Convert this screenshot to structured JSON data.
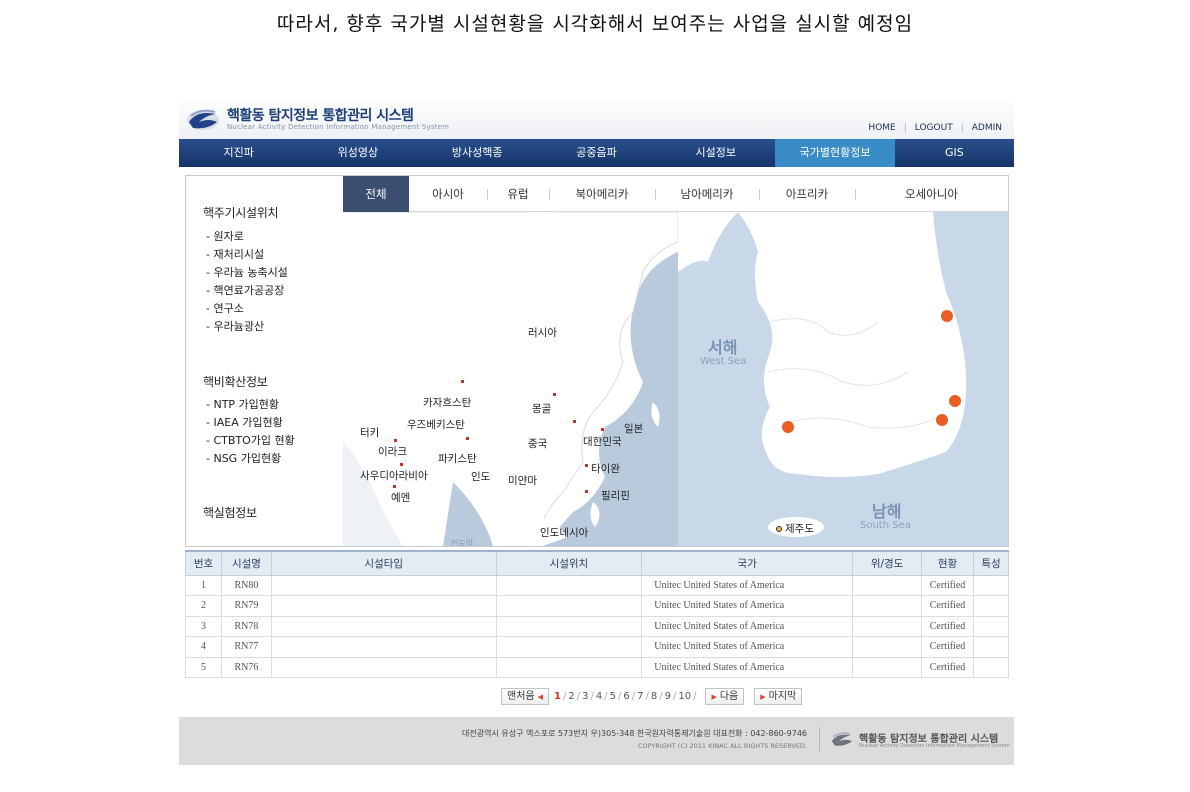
{
  "intro_sentence": "따라서, 향후 국가별 시설현황을 시각화해서 보여주는 사업을 실시할 예정임",
  "header": {
    "title": "핵활동 탐지정보 통합관리 시스템",
    "subtitle": "Nuclear Activity Detection Information Management System",
    "links": [
      "HOME",
      "LOGOUT",
      "ADMIN"
    ]
  },
  "nav": {
    "items": [
      "지진파",
      "위성영상",
      "방사성핵종",
      "공중음파",
      "시설정보",
      "국가별현황정보",
      "GIS"
    ],
    "active": "국가별현황정보"
  },
  "sidebar": {
    "section1": {
      "title": "핵주기시설위치",
      "items": [
        "원자로",
        "재처리시설",
        "우라늄 농축시설",
        "핵연료가공공장",
        "연구소",
        "우라늄광산"
      ]
    },
    "section2": {
      "title": "핵비확산정보",
      "items": [
        "NTP 가입현황",
        "IAEA 가입현황",
        "CTBTO가입 현황",
        "NSG 가입현황"
      ]
    },
    "section3": {
      "title": "핵실험정보"
    }
  },
  "region_tabs": {
    "items": [
      "전체",
      "아시아",
      "유럽",
      "북아메리카",
      "남아메리카",
      "아프리카",
      "오세아니아"
    ],
    "active": "전체"
  },
  "world_map": {
    "labels": [
      "러시아",
      "카자흐스탄",
      "몽골",
      "우즈베키스탄",
      "터키",
      "이라크",
      "파키스탄",
      "중국",
      "대한민국",
      "일본",
      "사우디아라비아",
      "인도",
      "미얀마",
      "타이완",
      "예멘",
      "필리핀",
      "인도네시아",
      "인도양"
    ]
  },
  "korea_map": {
    "west_sea_ko": "서해",
    "west_sea_en": "West Sea",
    "south_sea_ko": "남해",
    "south_sea_en": "South Sea",
    "jeju": "제주도",
    "facility_color": "#ea5e24"
  },
  "table": {
    "headers": [
      "번호",
      "시설명",
      "시설타입",
      "시설위치",
      "국가",
      "위/경도",
      "현황",
      "특성"
    ],
    "rows": [
      [
        "1",
        "RN80",
        "",
        "",
        "Unitec  United States of America",
        "",
        "Certified",
        ""
      ],
      [
        "2",
        "RN79",
        "",
        "",
        "Unitec  United States of America",
        "",
        "Certified",
        ""
      ],
      [
        "3",
        "RN78",
        "",
        "",
        "Unitec  United States of America",
        "",
        "Certified",
        ""
      ],
      [
        "4",
        "RN77",
        "",
        "",
        "Unitec  United States of America",
        "",
        "Certified",
        ""
      ],
      [
        "5",
        "RN76",
        "",
        "",
        "Unitec  United States of America",
        "",
        "Certified",
        ""
      ]
    ]
  },
  "pager": {
    "first": "맨처음",
    "pages": [
      "1",
      "2",
      "3",
      "4",
      "5",
      "6",
      "7",
      "8",
      "9",
      "10"
    ],
    "current": "1",
    "next": "다음",
    "last": "마지막"
  },
  "footer": {
    "address": "대전광역시 유성구 엑스포로 573번지 우)305-348  한국원자력통제기술원  대표전화 : 042-860-9746",
    "copyright": "COPYRIGHT (C) 2011 KINAC ALL RIGHTS RESERVED.",
    "logo_title": "핵활동 탐지정보 통합관리 시스템",
    "logo_sub": "Nuclear Activity Detection Information Management System"
  },
  "colors": {
    "nav_bg": "#1f3f7a",
    "nav_active": "#3a8cc6",
    "tab_active": "#3b4e6f",
    "sea": "#c8d8e9"
  }
}
